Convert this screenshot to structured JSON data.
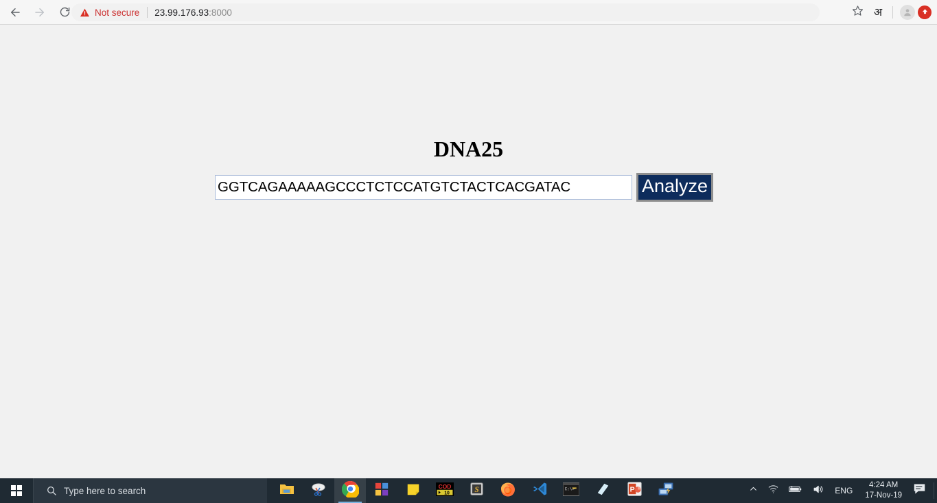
{
  "browser": {
    "back_icon": "back-arrow-icon",
    "forward_icon": "forward-arrow-icon",
    "reload_icon": "reload-icon",
    "security_label": "Not secure",
    "security_icon": "warning-triangle-icon",
    "url_host": "23.99.176.93",
    "url_port": ":8000",
    "url_full": "23.99.176.93:8000",
    "bookmark_icon": "star-icon",
    "language_glyph": "अ",
    "profile_icon": "avatar-icon",
    "update_icon": "update-arrow-icon",
    "colors": {
      "toolbar_bg": "#f6f6f6",
      "omnibox_bg": "#f1f1f1",
      "not_secure": "#cc3333",
      "update_badge": "#d93025"
    }
  },
  "page": {
    "title": "DNA25",
    "background": "#f1f1f1",
    "input": {
      "value": "GGTCAGAAAAAGCCCTCTCCATGTCTACTCACGATAC",
      "placeholder": ""
    },
    "analyze_button": {
      "label": "Analyze",
      "background": "#0d2c5c",
      "text_color": "#ffffff"
    }
  },
  "taskbar": {
    "start_icon": "windows-logo-icon",
    "search": {
      "icon": "search-icon",
      "placeholder": "Type here to search"
    },
    "apps": [
      {
        "name": "file-explorer",
        "label": "File Explorer",
        "active": false
      },
      {
        "name": "snipping-tool",
        "label": "Snipping Tool",
        "active": false
      },
      {
        "name": "google-chrome",
        "label": "Google Chrome",
        "active": true
      },
      {
        "name": "microsoft-store",
        "label": "Microsoft Store",
        "active": false
      },
      {
        "name": "sticky-notes",
        "label": "Sticky Notes",
        "active": false
      },
      {
        "name": "cod-10",
        "label": "COD 10",
        "active": false
      },
      {
        "name": "s-app",
        "label": "S App",
        "active": false
      },
      {
        "name": "mozilla-firefox",
        "label": "Mozilla Firefox",
        "active": false
      },
      {
        "name": "visual-studio-code",
        "label": "Visual Studio Code",
        "active": false
      },
      {
        "name": "command-prompt",
        "label": "Command Prompt",
        "active": false
      },
      {
        "name": "blue-notebook-app",
        "label": "OneNote",
        "active": false
      },
      {
        "name": "powerpoint",
        "label": "PowerPoint",
        "active": false
      },
      {
        "name": "remote-desktop",
        "label": "Remote Desktop",
        "active": false
      }
    ],
    "cod_icon": {
      "top_text": "COD",
      "bottom_text": "10"
    },
    "powerpoint_glyph": "P",
    "s_app_glyph": "S",
    "tray": {
      "overflow_icon": "chevron-up-icon",
      "network_icon": "wifi-icon",
      "battery_icon": "battery-icon",
      "volume_icon": "speaker-icon",
      "language": "ENG",
      "time": "4:24 AM",
      "date": "17-Nov-19",
      "notification_icon": "notification-icon"
    }
  }
}
